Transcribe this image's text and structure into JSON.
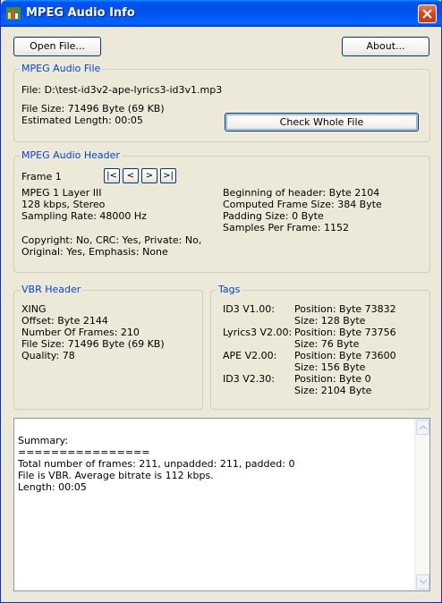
{
  "window": {
    "title": "MPEG Audio Info"
  },
  "toolbar": {
    "open_file": "Open File...",
    "about": "About..."
  },
  "audio_file": {
    "group_title": "MPEG Audio File",
    "file": "File: D:\\test-id3v2-ape-lyrics3-id3v1.mp3",
    "file_size": "File Size: 71496 Byte (69 KB)",
    "estimated_length": "Estimated Length: 00:05",
    "check_button": "Check Whole File"
  },
  "audio_header": {
    "group_title": "MPEG Audio Header",
    "frame": "Frame 1",
    "nav": {
      "first": "|<",
      "prev": "<",
      "next": ">",
      "last": ">|"
    },
    "left": [
      "MPEG 1 Layer III",
      "128 kbps, Stereo",
      "Sampling Rate: 48000 Hz"
    ],
    "right": [
      "Beginning of header: Byte 2104",
      "Computed Frame Size: 384 Byte",
      "Padding Size: 0 Byte",
      "Samples Per Frame: 1152"
    ],
    "flags": [
      "Copyright: No, CRC: Yes, Private: No,",
      "Original: Yes, Emphasis: None"
    ]
  },
  "vbr": {
    "group_title": "VBR Header",
    "lines": [
      "XING",
      "Offset: Byte 2144",
      "Number Of Frames: 210",
      "File Size: 71496 Byte (69 KB)",
      "Quality: 78"
    ]
  },
  "tags": {
    "group_title": "Tags",
    "items": [
      {
        "name": "ID3 V1.00:",
        "position": "Position: Byte 73832",
        "size": "Size: 128 Byte"
      },
      {
        "name": "Lyrics3 V2.00:",
        "position": "Position: Byte 73756",
        "size": "Size: 76 Byte"
      },
      {
        "name": "APE V2.00:",
        "position": "Position: Byte 73600",
        "size": "Size: 156 Byte"
      },
      {
        "name": "ID3 V2.30:",
        "position": "Position: Byte 0",
        "size": "Size: 2104 Byte"
      }
    ]
  },
  "summary": {
    "lines": [
      "Summary:",
      "================",
      "Total number of frames: 211, unpadded: 211, padded: 0",
      "File is VBR. Average bitrate is 112 kbps.",
      "Length: 00:05"
    ]
  }
}
